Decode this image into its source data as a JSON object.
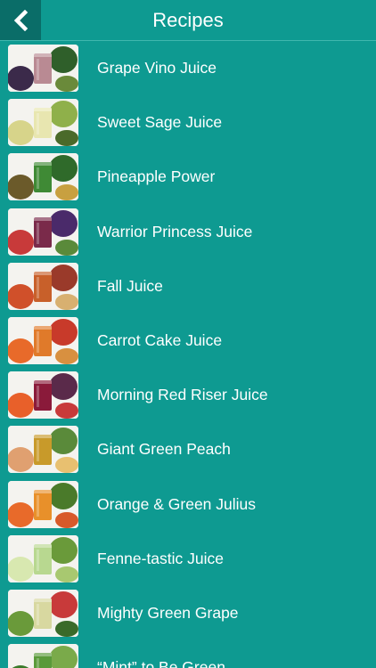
{
  "header": {
    "title": "Recipes",
    "back_icon": "chevron-left-icon"
  },
  "colors": {
    "background": "#0e9a91",
    "back_button": "#0a6d68",
    "text": "#ffffff"
  },
  "recipes": [
    {
      "label": "Grape Vino Juice",
      "thumb": {
        "juice": "#b98a93",
        "produce": [
          "#3b2a4a",
          "#2f5f2a",
          "#6a8a3a"
        ]
      }
    },
    {
      "label": "Sweet Sage Juice",
      "thumb": {
        "juice": "#e8e6b0",
        "produce": [
          "#d7d48a",
          "#8fb04a",
          "#4a6a2a"
        ]
      }
    },
    {
      "label": "Pineapple Power",
      "thumb": {
        "juice": "#3f8a35",
        "produce": [
          "#6b5a2a",
          "#2f6a2a",
          "#c8a040"
        ]
      }
    },
    {
      "label": "Warrior Princess Juice",
      "thumb": {
        "juice": "#7a2a4a",
        "produce": [
          "#c83a3a",
          "#4a2a6a",
          "#5a8a3a"
        ]
      }
    },
    {
      "label": "Fall Juice",
      "thumb": {
        "juice": "#c8602a",
        "produce": [
          "#d0502a",
          "#9a3a2a",
          "#d8b070"
        ]
      }
    },
    {
      "label": "Carrot Cake Juice",
      "thumb": {
        "juice": "#e07a2a",
        "produce": [
          "#e86a2a",
          "#c83a2a",
          "#d89040"
        ]
      }
    },
    {
      "label": "Morning Red Riser Juice",
      "thumb": {
        "juice": "#8a1a3a",
        "produce": [
          "#e8602a",
          "#5a2a4a",
          "#c83a3a"
        ]
      }
    },
    {
      "label": "Giant Green Peach",
      "thumb": {
        "juice": "#c89a2a",
        "produce": [
          "#e0a070",
          "#5a8a3a",
          "#e8c070"
        ]
      }
    },
    {
      "label": "Orange & Green Julius",
      "thumb": {
        "juice": "#e8902a",
        "produce": [
          "#e86a2a",
          "#4a7a2a",
          "#d85a2a"
        ]
      }
    },
    {
      "label": "Fenne-tastic Juice",
      "thumb": {
        "juice": "#b8d890",
        "produce": [
          "#d8e8b0",
          "#6a9a3a",
          "#a8c870"
        ]
      }
    },
    {
      "label": "Mighty Green Grape",
      "thumb": {
        "juice": "#d8d8a0",
        "produce": [
          "#6a9a3a",
          "#c83a3a",
          "#3a6a2a"
        ]
      }
    },
    {
      "label": "“Mint” to Be Green",
      "thumb": {
        "juice": "#5a9a3a",
        "produce": [
          "#3a7a2a",
          "#7aaa4a",
          "#2a5a2a"
        ]
      }
    }
  ]
}
